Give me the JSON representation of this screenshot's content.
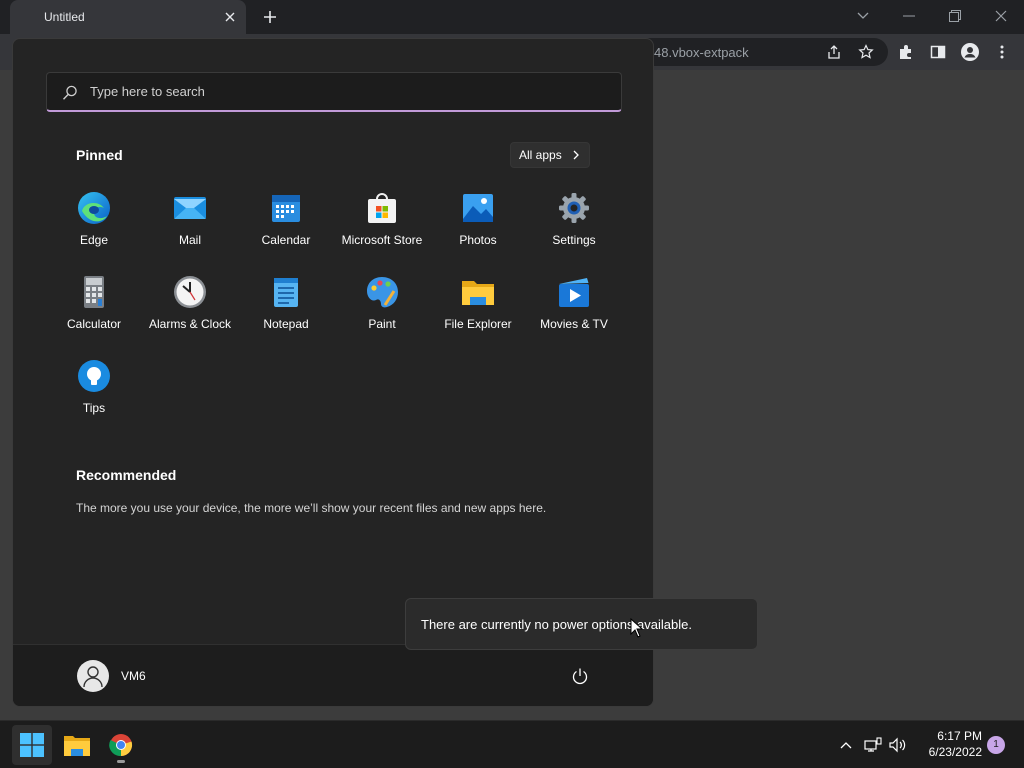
{
  "browser": {
    "tab_title": "Untitled",
    "url_fragment": "48.vbox-extpack"
  },
  "start_menu": {
    "search_placeholder": "Type here to search",
    "pinned_title": "Pinned",
    "all_apps_label": "All apps",
    "apps": [
      {
        "label": "Edge",
        "icon": "edge-icon"
      },
      {
        "label": "Mail",
        "icon": "mail-icon"
      },
      {
        "label": "Calendar",
        "icon": "calendar-icon"
      },
      {
        "label": "Microsoft Store",
        "icon": "store-icon"
      },
      {
        "label": "Photos",
        "icon": "photos-icon"
      },
      {
        "label": "Settings",
        "icon": "gear-icon"
      },
      {
        "label": "Calculator",
        "icon": "calculator-icon"
      },
      {
        "label": "Alarms & Clock",
        "icon": "clock-icon"
      },
      {
        "label": "Notepad",
        "icon": "notepad-icon"
      },
      {
        "label": "Paint",
        "icon": "paint-icon"
      },
      {
        "label": "File Explorer",
        "icon": "folder-icon"
      },
      {
        "label": "Movies & TV",
        "icon": "movies-icon"
      },
      {
        "label": "Tips",
        "icon": "lightbulb-icon"
      }
    ],
    "recommended_title": "Recommended",
    "recommended_text": "The more you use your device, the more we’ll show your recent files and new apps here.",
    "user_name": "VM6"
  },
  "tooltip": {
    "text": "There are currently no power options available."
  },
  "taskbar": {
    "time": "6:17 PM",
    "date": "6/23/2022",
    "notification_count": "1"
  },
  "colors": {
    "accent": "#c19ad8",
    "start_bg": "#242424",
    "taskbar_bg": "#1c1c1c"
  }
}
